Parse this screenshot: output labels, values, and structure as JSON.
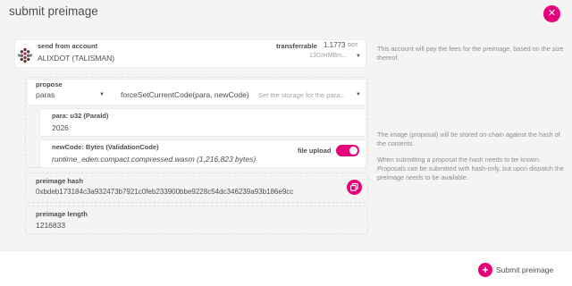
{
  "modal": {
    "title": "submit preimage",
    "close_icon": "close-icon"
  },
  "account": {
    "label": "send from account",
    "name": "ALIXDOT (TALISMAN)",
    "transferrable_label": "transferrable",
    "transferrable_value": "1.1773",
    "transferrable_unit": "DOT",
    "address_short": "13GrHMBm...",
    "help": "This account will pay the fees for the preimage, based on the size thereof."
  },
  "propose": {
    "label": "propose",
    "module": "paras",
    "call": "forceSetCurrentCode(para, newCode)",
    "call_description": "Set the storage for the para..."
  },
  "params": {
    "para_label": "para: u32 (ParaId)",
    "para_value": "2026",
    "newcode_label": "newCode: Bytes (ValidationCode)",
    "newcode_value": "runtime_eden.compact.compressed.wasm (1,216,823 bytes)",
    "file_upload_label": "file upload",
    "file_upload_enabled": true
  },
  "preimage": {
    "hash_label": "preimage hash",
    "hash_value": "0xbdeb173184c3a932473b7921c0feb233900bbe9228c54dc346239a93b186e9cc",
    "length_label": "preimage length",
    "length_value": "1216833"
  },
  "help_texts": {
    "image": "The image (proposal) will be stored on-chain against the hash of the contents.",
    "submit": "When submitting a proposal the hash needs to be known. Proposals can be submitted with hash-only, but upon dispatch the preimage needs to be available."
  },
  "footer": {
    "submit_label": "Submit preimage"
  },
  "colors": {
    "accent": "#e6007a",
    "background": "#f5f4f3",
    "text": "#4e4e4e"
  }
}
